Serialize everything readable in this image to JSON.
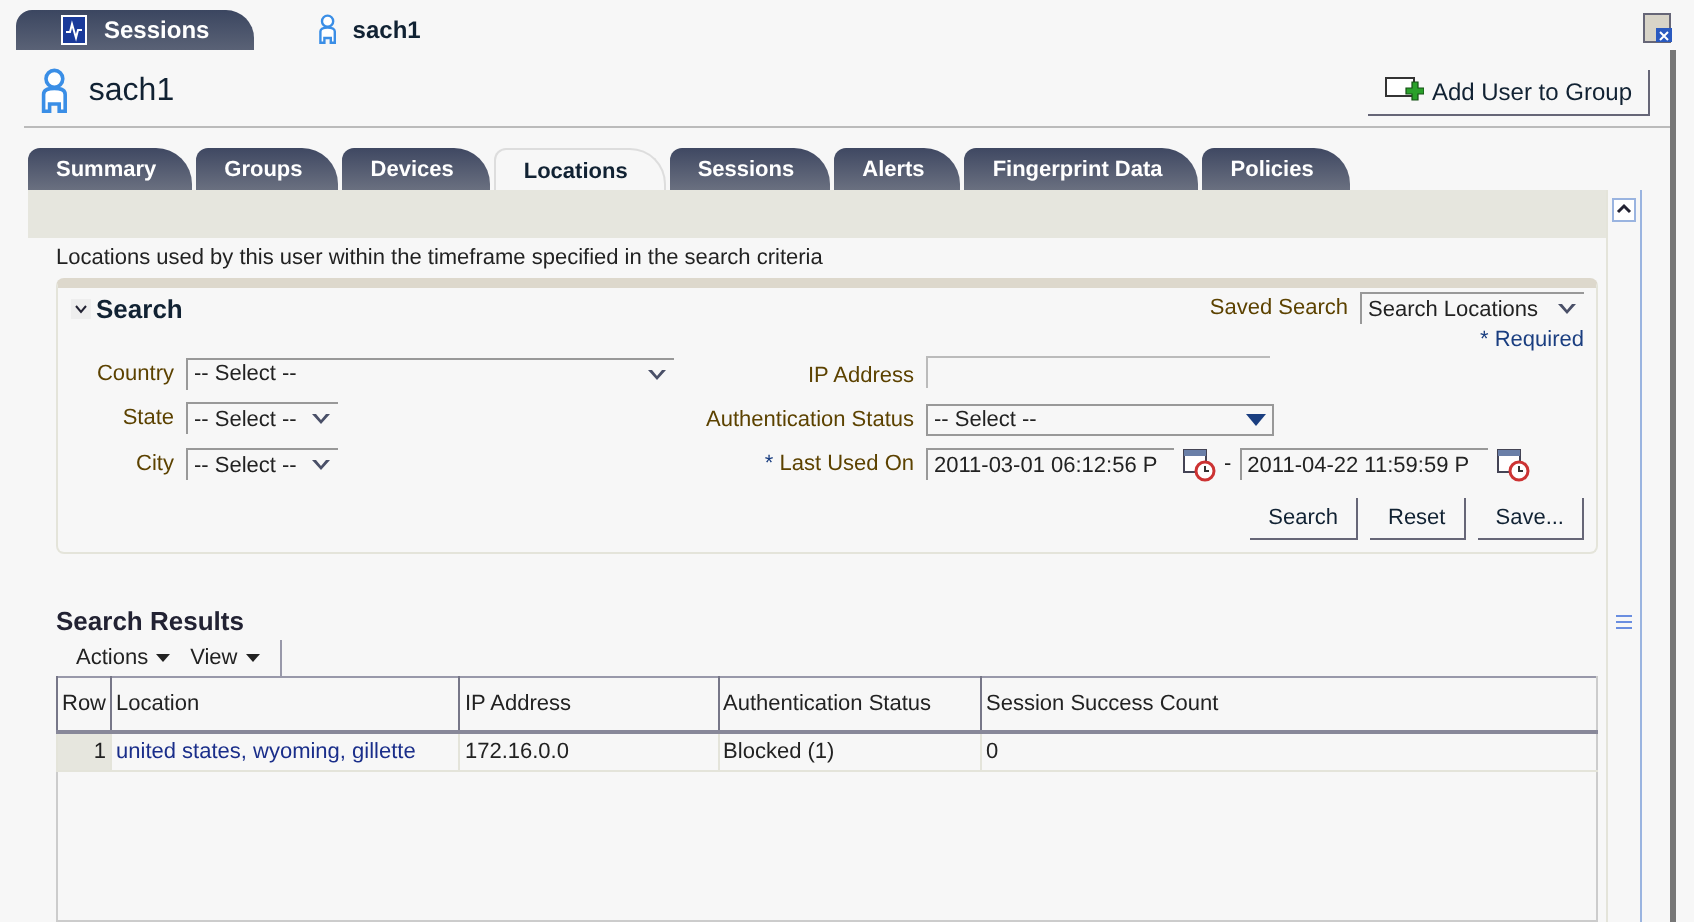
{
  "doc_tabs": [
    {
      "label": "Sessions",
      "kind": "sessions",
      "selected": true
    },
    {
      "label": "sach1",
      "kind": "user",
      "selected": false
    }
  ],
  "header": {
    "title": "sach1",
    "add_button": "Add User to Group"
  },
  "tabs": [
    {
      "label": "Summary",
      "selected": false
    },
    {
      "label": "Groups",
      "selected": false
    },
    {
      "label": "Devices",
      "selected": false
    },
    {
      "label": "Locations",
      "selected": true
    },
    {
      "label": "Sessions",
      "selected": false
    },
    {
      "label": "Alerts",
      "selected": false
    },
    {
      "label": "Fingerprint Data",
      "selected": false
    },
    {
      "label": "Policies",
      "selected": false
    }
  ],
  "description": "Locations used by this user within the timeframe specified in the search criteria",
  "search": {
    "title": "Search",
    "expanded": true,
    "saved_search_label": "Saved Search",
    "saved_search_value": "Search Locations",
    "required_note": "* Required",
    "left_fields": [
      {
        "label": "Country",
        "value": "-- Select --",
        "kind": "wide"
      },
      {
        "label": "State",
        "value": "-- Select --",
        "kind": "narrow"
      },
      {
        "label": "City",
        "value": "-- Select --",
        "kind": "narrow"
      }
    ],
    "ip_address": {
      "label": "IP Address"
    },
    "auth_status": {
      "label": "Authentication Status",
      "value": "-- Select --"
    },
    "last_used": {
      "required_mark": "*",
      "label": "Last Used On",
      "from": "2011-03-01 06:12:56 P",
      "separator": "-",
      "to": "2011-04-22 11:59:59 P"
    },
    "buttons": [
      "Search",
      "Reset",
      "Save..."
    ]
  },
  "results": {
    "title": "Search Results",
    "menus": [
      "Actions",
      "View"
    ],
    "columns": [
      "Row",
      "Location",
      "IP Address",
      "Authentication Status",
      "Session Success Count"
    ],
    "rows": [
      {
        "row": "1",
        "location": "united states, wyoming, gillette",
        "ip_address": "172.16.0.0",
        "auth_status": "Blocked (1)",
        "success_count": "0"
      }
    ]
  }
}
